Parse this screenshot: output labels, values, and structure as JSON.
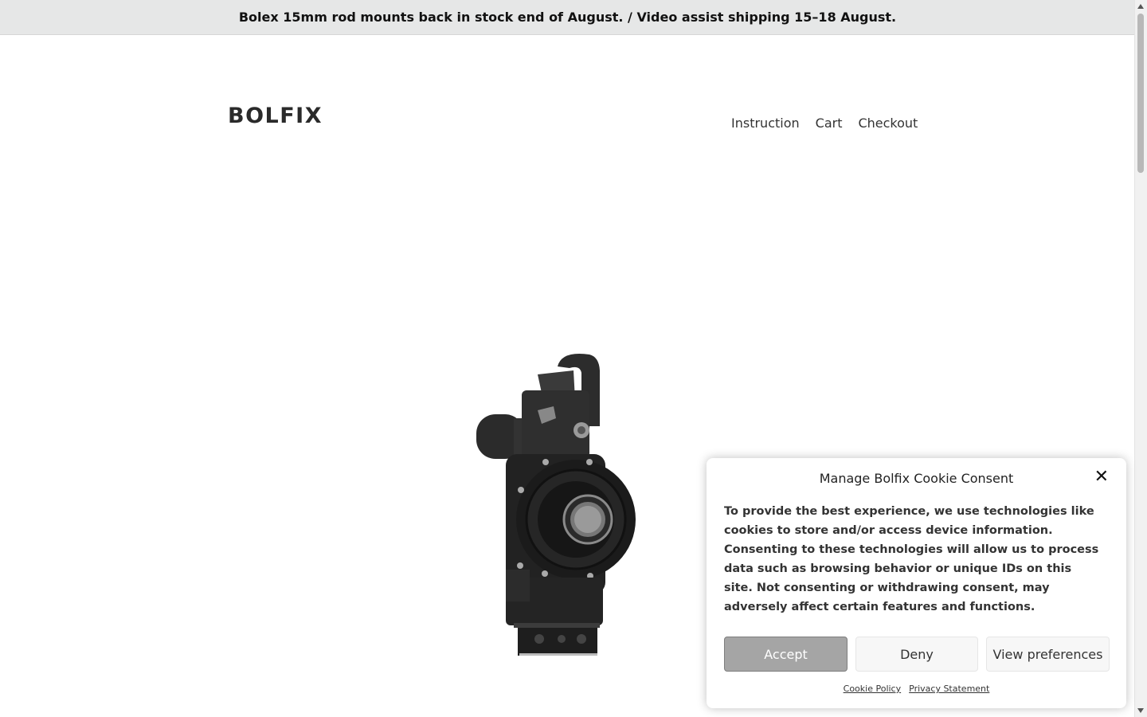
{
  "announcement": {
    "text": "Bolex 15mm rod mounts back in stock end of August. / Video assist shipping 15–18 August."
  },
  "header": {
    "logo": "BOLFIX",
    "nav": [
      {
        "label": "Instruction"
      },
      {
        "label": "Cart"
      },
      {
        "label": "Checkout"
      }
    ]
  },
  "product": {
    "image": "bolex-camera-image"
  },
  "cookie_banner": {
    "title": "Manage Bolfix Cookie Consent",
    "close_icon": "close-icon",
    "body": "To provide the best experience, we use technologies like cookies to store and/or access device information. Consenting to these technologies will allow us to process data such as browsing behavior or unique IDs on this site. Not consenting or withdrawing consent, may adversely affect certain features and functions.",
    "buttons": {
      "accept": "Accept",
      "deny": "Deny",
      "preferences": "View preferences"
    },
    "links": {
      "cookie_policy": "Cookie Policy",
      "privacy_statement": "Privacy Statement"
    }
  },
  "colors": {
    "announcement_bg": "#e6e7e7",
    "accept_bg": "#a5a5a5"
  }
}
